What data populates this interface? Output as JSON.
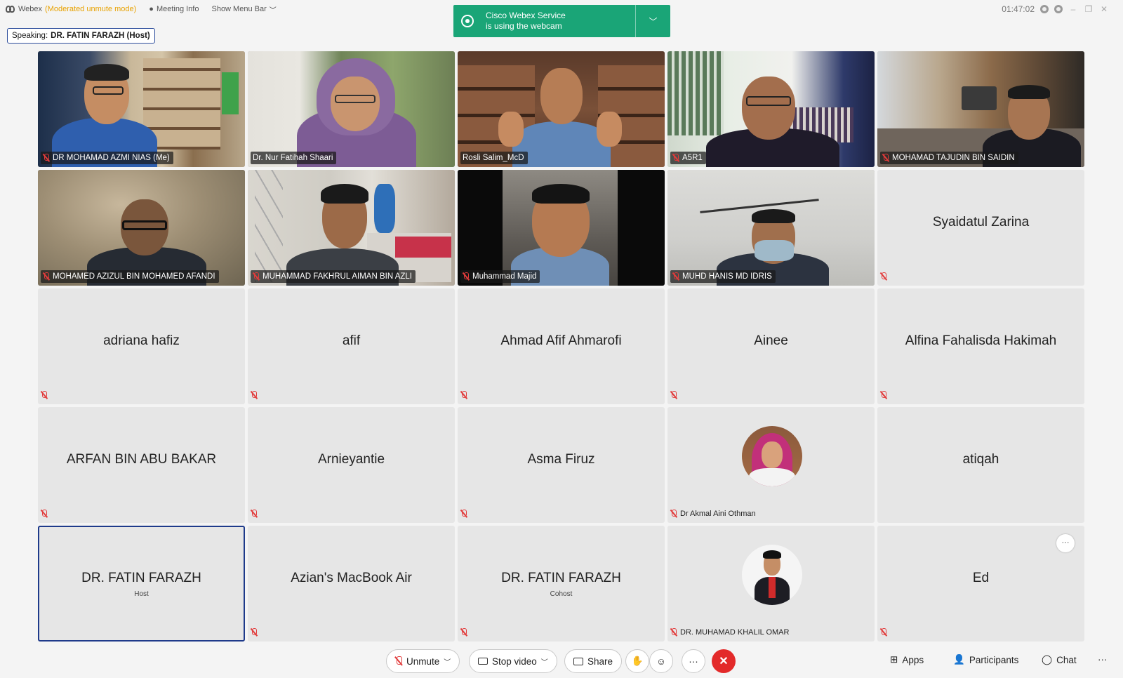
{
  "titlebar": {
    "app_name": "Webex",
    "mode": "(Moderated unmute mode)",
    "meeting_info": "Meeting Info",
    "show_menu_bar": "Show Menu Bar",
    "time": "01:47:02"
  },
  "webcam_notice": {
    "line1": "Cisco Webex Service",
    "line2": "is using the webcam"
  },
  "speaking": {
    "label": "Speaking:",
    "name": "DR. FATIN FARAZH (Host)"
  },
  "tiles": [
    {
      "name": "DR MOHAMAD AZMI NIAS (Me)",
      "type": "video"
    },
    {
      "name": "Dr. Nur Fatihah Shaari",
      "type": "video"
    },
    {
      "name": "Rosli Salim_McD",
      "type": "video"
    },
    {
      "name": "A5R1",
      "type": "video"
    },
    {
      "name": "MOHAMAD TAJUDIN BIN SAIDIN",
      "type": "video"
    },
    {
      "name": "MOHAMED AZIZUL BIN MOHAMED AFANDI",
      "type": "video"
    },
    {
      "name": "MUHAMMAD FAKHRUL AIMAN BIN AZLI",
      "type": "video"
    },
    {
      "name": "Muhammad Majid",
      "type": "video"
    },
    {
      "name": "MUHD HANIS MD IDRIS",
      "type": "video"
    },
    {
      "name": "Syaidatul Zarina",
      "type": "name"
    },
    {
      "name": "adriana hafiz",
      "type": "name"
    },
    {
      "name": "afif",
      "type": "name"
    },
    {
      "name": "Ahmad Afif Ahmarofi",
      "type": "name"
    },
    {
      "name": "Ainee",
      "type": "name"
    },
    {
      "name": "Alfina Fahalisda Hakimah",
      "type": "name"
    },
    {
      "name": "ARFAN BIN ABU BAKAR",
      "type": "name"
    },
    {
      "name": "Arnieyantie",
      "type": "name"
    },
    {
      "name": "Asma Firuz",
      "type": "name"
    },
    {
      "name": "Dr Akmal Aini Othman",
      "type": "avatar"
    },
    {
      "name": "atiqah",
      "type": "name"
    },
    {
      "name": "DR. FATIN FARAZH",
      "role": "Host",
      "type": "name"
    },
    {
      "name": "Azian's MacBook Air",
      "type": "name"
    },
    {
      "name": "DR. FATIN FARAZH",
      "role": "Cohost",
      "type": "name"
    },
    {
      "name": "DR. MUHAMAD KHALIL OMAR",
      "type": "avatar"
    },
    {
      "name": "Ed",
      "type": "name"
    }
  ],
  "more_label": "···",
  "toolbar": {
    "unmute": "Unmute",
    "stop_video": "Stop video",
    "share": "Share",
    "more": "···",
    "apps": "Apps",
    "participants": "Participants",
    "chat": "Chat",
    "overflow": "···"
  },
  "colors": {
    "webcam_banner": "#1aa577",
    "end_call": "#e32a2a",
    "mode_text": "#e8a200",
    "selected_border": "#1e3a8a"
  }
}
